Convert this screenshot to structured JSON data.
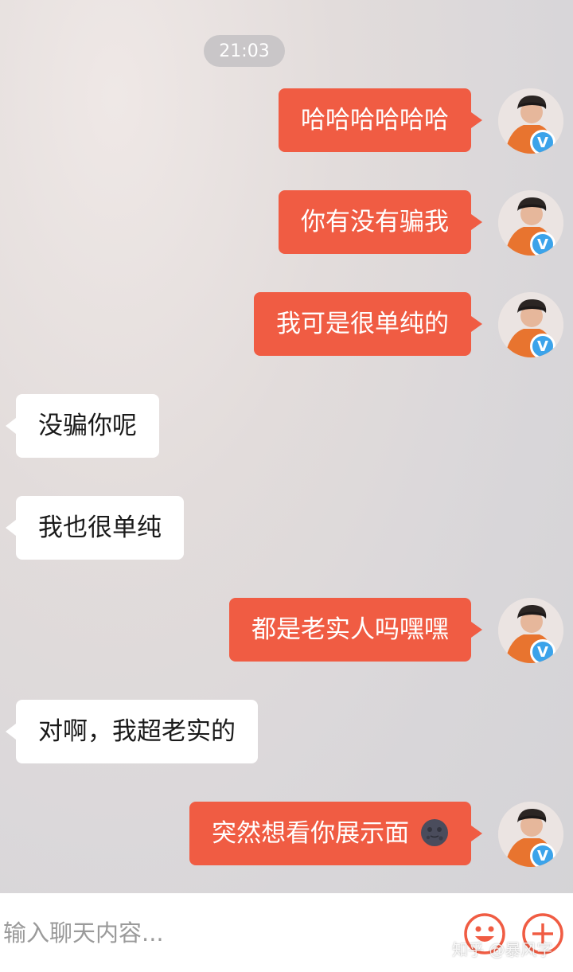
{
  "timestamp": "21:03",
  "messages": [
    {
      "side": "out",
      "text": "哈哈哈哈哈哈"
    },
    {
      "side": "out",
      "text": "你有没有骗我"
    },
    {
      "side": "out",
      "text": "我可是很单纯的"
    },
    {
      "side": "in",
      "text": "没骗你呢"
    },
    {
      "side": "in",
      "text": "我也很单纯"
    },
    {
      "side": "out",
      "text": "都是老实人吗嘿嘿"
    },
    {
      "side": "in",
      "text": "对啊，我超老实的"
    },
    {
      "side": "out",
      "text": "突然想看你展示面",
      "emoji": "new-moon-face"
    }
  ],
  "avatar_badge": "V",
  "input": {
    "placeholder": "输入聊天内容..."
  },
  "icons": {
    "emoji_button": "smiley-face-icon",
    "plus_button": "plus-circle-icon"
  },
  "colors": {
    "outgoing_bubble": "#f05c43",
    "incoming_bubble": "#ffffff",
    "badge": "#3ba3ea",
    "icon_accent": "#f05c43"
  },
  "watermark": "知乎 @暴风字"
}
